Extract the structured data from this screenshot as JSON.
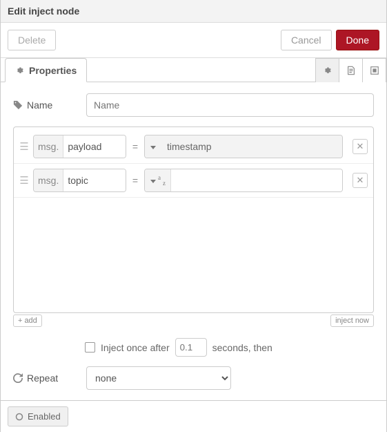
{
  "header": {
    "title": "Edit inject node"
  },
  "toolbar": {
    "delete_label": "Delete",
    "cancel_label": "Cancel",
    "done_label": "Done"
  },
  "tabs": {
    "properties_label": "Properties"
  },
  "form": {
    "name_label": "Name",
    "name_placeholder": "Name",
    "name_value": "",
    "msg_prefix": "msg.",
    "eq": "=",
    "rows": [
      {
        "prop": "payload",
        "type_label": "timestamp",
        "type_mode": "full",
        "value": ""
      },
      {
        "prop": "topic",
        "type_label": "",
        "type_mode": "az",
        "value": ""
      }
    ],
    "add_label": "add",
    "inject_now_label": "inject now",
    "inject_once_label": "Inject once after",
    "inject_once_delay_placeholder": "0.1",
    "inject_once_suffix": "seconds, then",
    "repeat_label": "Repeat",
    "repeat_value": "none"
  },
  "footer": {
    "enabled_label": "Enabled"
  },
  "icons": {
    "gear": "gear-icon",
    "doc": "doc-icon",
    "group": "group-icon",
    "tag": "tag-icon",
    "refresh": "refresh-icon",
    "circle": "circle-icon"
  }
}
